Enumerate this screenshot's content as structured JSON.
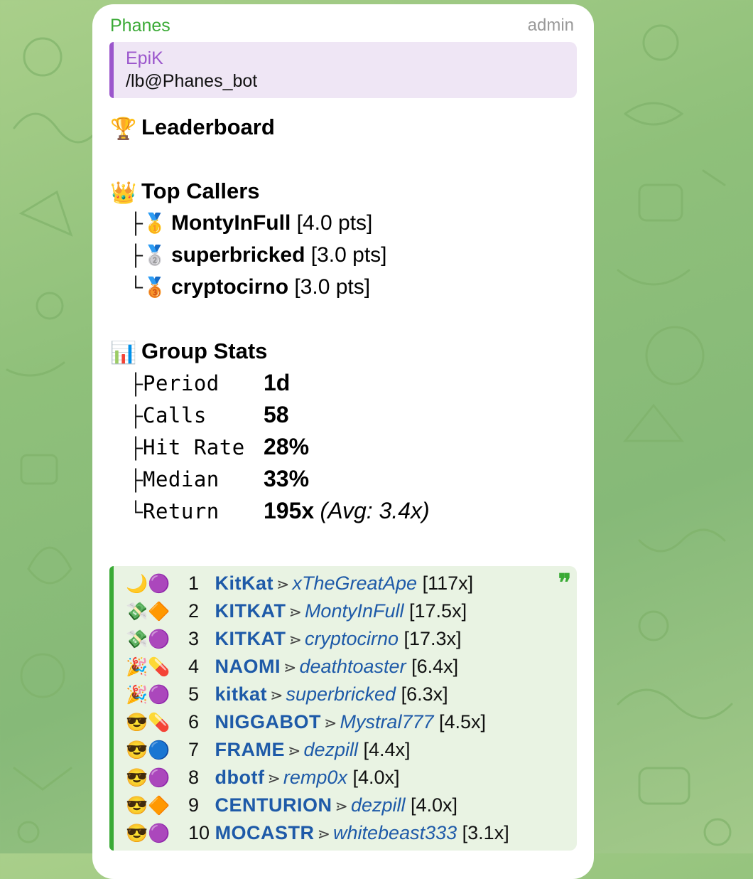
{
  "message": {
    "sender": "Phanes",
    "role": "admin",
    "reply": {
      "author": "EpiK",
      "text": "/lb@Phanes_bot"
    },
    "title": {
      "emoji": "🏆",
      "text": "Leaderboard"
    },
    "top_callers": {
      "emoji": "👑",
      "heading": "Top Callers",
      "items": [
        {
          "tree": "├",
          "medal": "🥇",
          "name": "MontyInFull",
          "pts": "[4.0 pts]"
        },
        {
          "tree": "├",
          "medal": "🥈",
          "name": "superbricked",
          "pts": "[3.0 pts]"
        },
        {
          "tree": "└",
          "medal": "🥉",
          "name": "cryptocirno",
          "pts": "[3.0 pts]"
        }
      ]
    },
    "group_stats": {
      "emoji": "📊",
      "heading": "Group Stats",
      "rows": [
        {
          "tree": "├",
          "label": "Period",
          "value": "1d",
          "extra": ""
        },
        {
          "tree": "├",
          "label": "Calls",
          "value": "58",
          "extra": ""
        },
        {
          "tree": "├",
          "label": "Hit Rate",
          "value": "28%",
          "extra": ""
        },
        {
          "tree": "├",
          "label": "Median",
          "value": "33%",
          "extra": ""
        },
        {
          "tree": "└",
          "label": "Return",
          "value": "195x",
          "extra": "(Avg: 3.4x)"
        }
      ]
    },
    "quote_mark": "❞",
    "calls": [
      {
        "emojis": "🌙🟣",
        "rank": "1",
        "token": "KitKat",
        "caller": "xTheGreatApe",
        "mult": "[117x]"
      },
      {
        "emojis": "💸🔶",
        "rank": "2",
        "token": "KITKAT",
        "caller": "MontyInFull",
        "mult": "[17.5x]"
      },
      {
        "emojis": "💸🟣",
        "rank": "3",
        "token": "KITKAT",
        "caller": "cryptocirno",
        "mult": "[17.3x]"
      },
      {
        "emojis": "🎉💊",
        "rank": "4",
        "token": "NAOMI",
        "caller": "deathtoaster",
        "mult": "[6.4x]"
      },
      {
        "emojis": "🎉🟣",
        "rank": "5",
        "token": "kitkat",
        "caller": "superbricked",
        "mult": "[6.3x]"
      },
      {
        "emojis": "😎💊",
        "rank": "6",
        "token": "NIGGABOT",
        "caller": "Mystral777",
        "mult": "[4.5x]"
      },
      {
        "emojis": "😎🔵",
        "rank": "7",
        "token": "FRAME",
        "caller": "dezpill",
        "mult": "[4.4x]"
      },
      {
        "emojis": "😎🟣",
        "rank": "8",
        "token": "dbotf",
        "caller": "remp0x",
        "mult": "[4.0x]"
      },
      {
        "emojis": "😎🔶",
        "rank": "9",
        "token": "CENTURION",
        "caller": "dezpill",
        "mult": "[4.0x]"
      },
      {
        "emojis": "😎🟣",
        "rank": "10",
        "token": "MOCASTR",
        "caller": "whitebeast333",
        "mult": "[3.1x]"
      }
    ],
    "arrow": "⋗"
  },
  "colors": {
    "background": "#8fc07a",
    "sender": "#3aaa35",
    "reply_accent": "#9b56cc",
    "link": "#1e5aa8"
  }
}
